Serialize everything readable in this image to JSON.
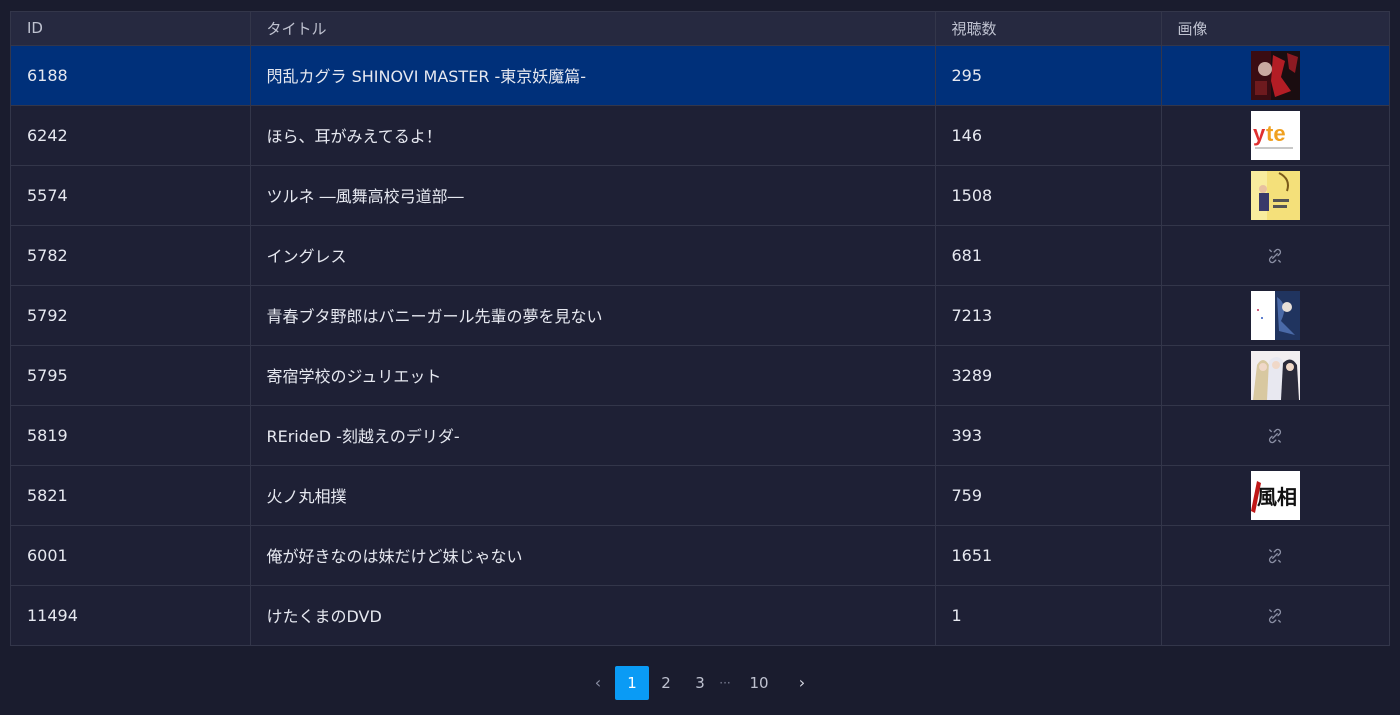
{
  "table": {
    "headers": {
      "id": "ID",
      "title": "タイトル",
      "views": "視聴数",
      "image": "画像"
    },
    "rows": [
      {
        "id": "6188",
        "title": "閃乱カグラ SHINOVI MASTER -東京妖魔篇-",
        "views": "295",
        "image": "thumb-dark-red",
        "selected": true
      },
      {
        "id": "6242",
        "title": "ほら、耳がみえてるよ！",
        "views": "146",
        "image": "thumb-yte-logo",
        "thumb_text": "yte",
        "selected": false
      },
      {
        "id": "5574",
        "title": "ツルネ ―風舞高校弓道部―",
        "views": "1508",
        "image": "thumb-yellow",
        "selected": false
      },
      {
        "id": "5782",
        "title": "イングレス",
        "views": "681",
        "image": "broken-image-icon",
        "selected": false
      },
      {
        "id": "5792",
        "title": "青春ブタ野郎はバニーガール先輩の夢を見ない",
        "views": "7213",
        "image": "thumb-blue-white",
        "selected": false
      },
      {
        "id": "5795",
        "title": "寄宿学校のジュリエット",
        "views": "3289",
        "image": "thumb-characters",
        "selected": false
      },
      {
        "id": "5819",
        "title": "RErideD -刻越えのデリダ-",
        "views": "393",
        "image": "broken-image-icon",
        "selected": false
      },
      {
        "id": "5821",
        "title": "火ノ丸相撲",
        "views": "759",
        "image": "thumb-calligraphy",
        "thumb_text": "風相",
        "selected": false
      },
      {
        "id": "6001",
        "title": "俺が好きなのは妹だけど妹じゃない",
        "views": "1651",
        "image": "broken-image-icon",
        "selected": false
      },
      {
        "id": "11494",
        "title": "けたくまのDVD",
        "views": "1",
        "image": "broken-image-icon",
        "selected": false
      }
    ]
  },
  "pagination": {
    "prev_icon": "chevron-left-icon",
    "next_icon": "chevron-right-icon",
    "pages": [
      "1",
      "2",
      "3"
    ],
    "ellipsis": "···",
    "last_page": "10",
    "current": "1"
  },
  "colors": {
    "background": "#1a1c2e",
    "header": "#262940",
    "row": "#1e2035",
    "selected_row": "#00307a",
    "active_page": "#0a9bf5"
  }
}
